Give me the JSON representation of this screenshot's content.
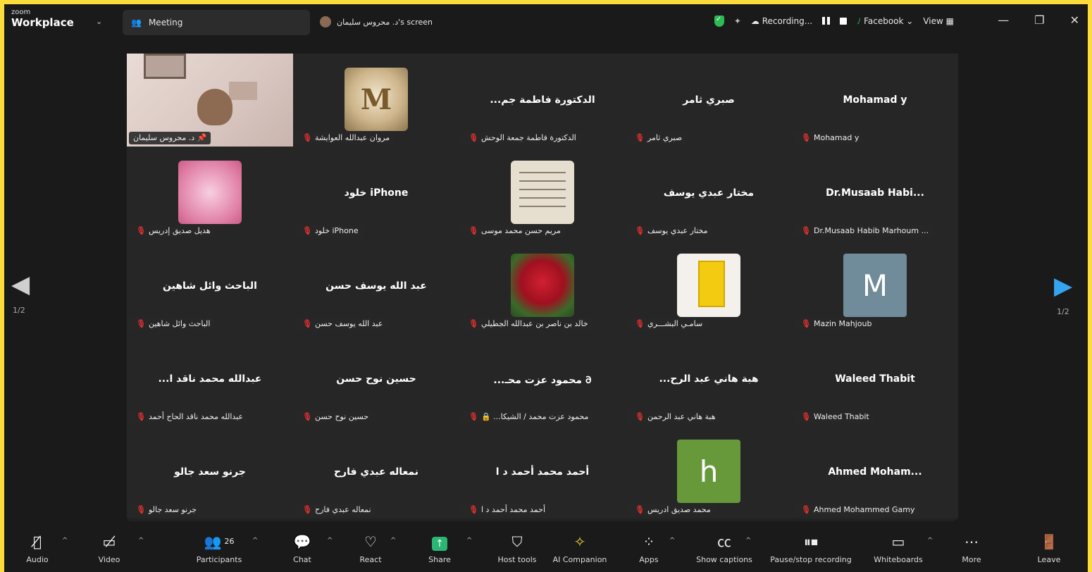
{
  "window": {
    "brand_top": "zoom",
    "brand_bottom": "Workplace",
    "meeting_label": "Meeting",
    "screen_label": "د. محروس سليمان's screen",
    "recording_label": "Recording...",
    "stream_label": "Facebook",
    "view_label": "View"
  },
  "gallery": {
    "page_left": "1/2",
    "page_right": "1/2",
    "tiles": [
      {
        "label": "د. محروس سليمان",
        "type": "video"
      },
      {
        "label": "مروان عبدالله العوايشة",
        "type": "image"
      },
      {
        "name": "...الدكتورة فاطمة جم",
        "label": "الدكتورة فاطمة جمعة الوحش"
      },
      {
        "name": "صبري ثامر",
        "label": "صبري ثامر"
      },
      {
        "name": "Mohamad y",
        "label": "Mohamad y"
      },
      {
        "label": "هديل صديق إدريس",
        "type": "image"
      },
      {
        "name": "خلود iPhone",
        "label": "خلود iPhone"
      },
      {
        "label": "مريم حسن محمد موسى",
        "type": "image"
      },
      {
        "name": "مختار عبدي يوسف",
        "label": "مختار عبدي يوسف"
      },
      {
        "name": "Dr.Musaab  Habi...",
        "label": "Dr.Musaab Habib Marhoum ..."
      },
      {
        "name": "الباحث وائل شاهين",
        "label": "الباحث وائل شاهين"
      },
      {
        "name": "عبد الله يوسف حسن",
        "label": "عبد الله يوسف حسن"
      },
      {
        "label": "خالد بن ناصر بن عبدالله الجطيلي",
        "type": "image"
      },
      {
        "label": "سامـي البشـــري",
        "type": "image"
      },
      {
        "label": "Mazin Mahjoub",
        "type": "letter",
        "letter": "M"
      },
      {
        "name": "...عبدالله محمد ناقد ا",
        "label": "عبدالله محمد ناقد الحاج أحمد"
      },
      {
        "name": "حسين نوح حسن",
        "label": "حسين نوح حسن"
      },
      {
        "name": "...محمود عزت محـ 𐐀",
        "label": "...محمود عزت محمد / الشيكا"
      },
      {
        "name": "...هبة هاني عبد الرح",
        "label": "هبة هاني عبد الرحمن"
      },
      {
        "name": "Waleed Thabit",
        "label": "Waleed Thabit"
      },
      {
        "name": "جرنو سعد جالو",
        "label": "جرنو سعد جالو"
      },
      {
        "name": "نمعاله عبدي فارح",
        "label": "نمعاله عبدي فارح"
      },
      {
        "name": "أحمد محمد أحمد د ا",
        "label": "أحمد محمد أحمد د ا"
      },
      {
        "label": "محمد صديق ادريس",
        "type": "letter",
        "letter": "h"
      },
      {
        "name": "Ahmed  Moham...",
        "label": "Ahmed Mohammed Gamy"
      }
    ]
  },
  "toolbar": {
    "audio": "Audio",
    "video": "Video",
    "participants": "Participants",
    "participants_count": "26",
    "chat": "Chat",
    "react": "React",
    "share": "Share",
    "host_tools": "Host tools",
    "ai_companion": "AI Companion",
    "apps": "Apps",
    "show_captions": "Show captions",
    "pause_stop": "Pause/stop recording",
    "whiteboards": "Whiteboards",
    "more": "More",
    "leave": "Leave"
  },
  "colors": {
    "frame": "#fbdc3c",
    "background": "#1a1a1a",
    "active_border": "#1ed38c",
    "muted_red": "#e02f2f",
    "share_green": "#2bb673",
    "nav_blue": "#35a4ef"
  }
}
